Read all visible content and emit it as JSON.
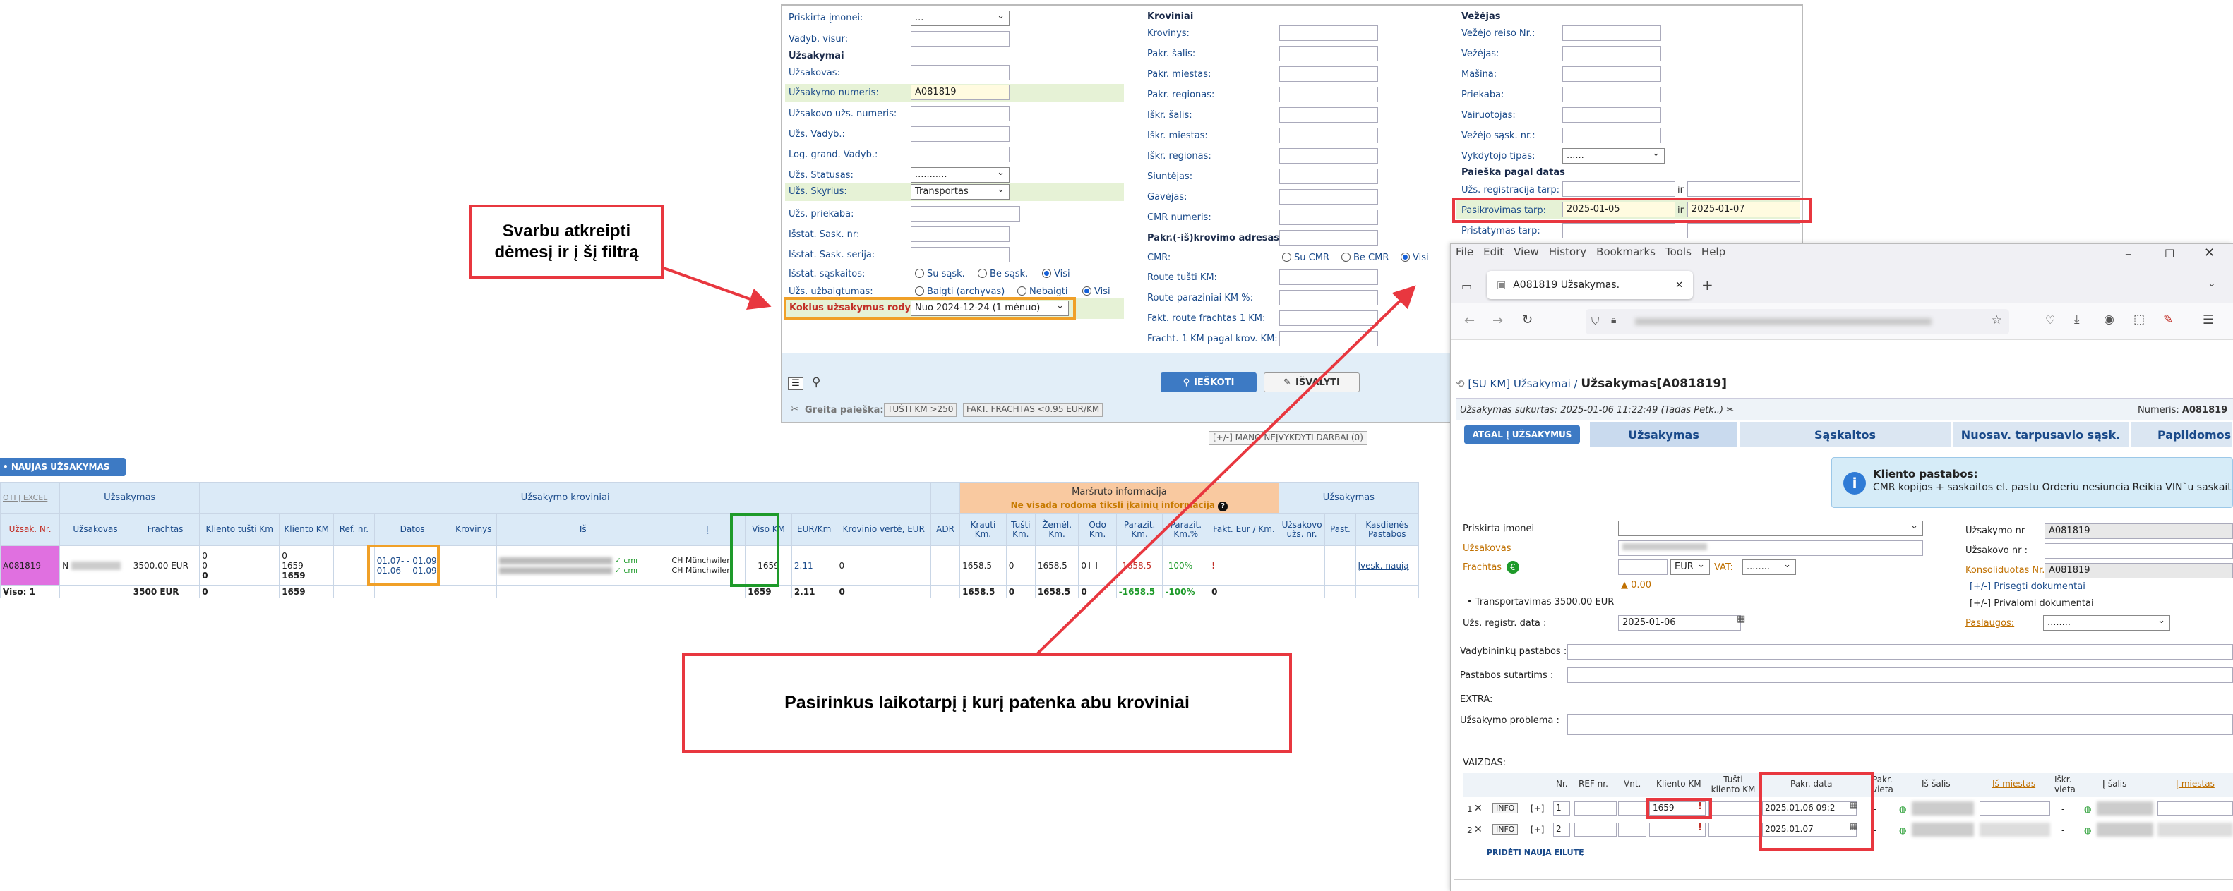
{
  "callouts": {
    "filter_note": "Svarbu atkreipti dėmesį ir į šį filtrą",
    "period_note": "Pasirinkus laikotarpį į kurį patenka abu kroviniai"
  },
  "search_form": {
    "left": {
      "priskirta_label": "Priskirta įmonei:",
      "priskirta_value": "...",
      "vadyb_label": "Vadyb. visur:",
      "section_uzsakymai": "Užsakymai",
      "uzsakovas_label": "Užsakovas:",
      "uzs_nr_label": "Užsakymo numeris:",
      "uzs_nr_value": "A081819",
      "uzsakovo_nr_label": "Užsakovo užs. numeris:",
      "uzs_vadyb_label": "Užs. Vadyb.:",
      "log_grand_label": "Log. grand. Vadyb.:",
      "uzs_status_label": "Užs. Statusas:",
      "uzs_status_value": "...........",
      "uzs_skyrius_label": "Užs. Skyrius:",
      "uzs_skyrius_value": "Transportas",
      "uzs_priekaba_label": "Užs. priekaba:",
      "israst_sask_nr_label": "Išstat. Sask. nr:",
      "israst_sask_serija_label": "Išstat. Sask. serija:",
      "israst_saskaitos_label": "Išstat. sąskaitos:",
      "israst_opts": [
        "Su sąsk.",
        "Be sąsk.",
        "Visi"
      ],
      "uzs_uzbaigtumas_label": "Užs. užbaigtumas:",
      "uzbaig_opts": [
        "Baigti (archyvas)",
        "Nebaigti",
        "Visi"
      ],
      "kokius_label": "Kokius užsakymus rodyti:",
      "kokius_value": "Nuo 2024-12-24 (1 mėnuo)"
    },
    "mid": {
      "section": "Kroviniai",
      "labels": [
        "Krovinys:",
        "Pakr. šalis:",
        "Pakr. miestas:",
        "Pakr. regionas:",
        "Iškr. šalis:",
        "Iškr. miestas:",
        "Iškr. regionas:",
        "Siuntėjas:",
        "Gavėjas:",
        "CMR numeris:"
      ],
      "pakr_adresas": "Pakr.(-iš)krovimo adresas:",
      "cmr_label": "CMR:",
      "cmr_opts": [
        "Su CMR",
        "Be CMR",
        "Visi"
      ],
      "labels2": [
        "Route tušti KM:",
        "Route paraziniai KM %:",
        "Fakt. route frachtas 1 KM:",
        "Fracht. 1 KM pagal krov. KM:"
      ]
    },
    "right": {
      "section": "Vežėjas",
      "labels": [
        "Vežėjo reiso Nr.:",
        "Vežėjas:",
        "Mašina:",
        "Priekaba:",
        "Vairuotojas:",
        "Vežėjo sąsk. nr.:"
      ],
      "vykdytojo_label": "Vykdytojo tipas:",
      "vykdytojo_value": "......",
      "section_datos": "Paieška pagal datas",
      "uzs_reg_label": "Užs. registracija tarp:",
      "pasikr_label": "Pasikrovimas tarp:",
      "pasikr_from": "2025-01-05",
      "pasikr_to": "2025-01-07",
      "pristat_label": "Pristatymas tarp:",
      "ir": "ir"
    },
    "search_btn": "IEŠKOTI",
    "clear_btn": "IŠVALYTI",
    "quick_label": "Greita paieška:",
    "quick1": "TUŠTI KM >250",
    "quick2": "FAKT. FRACHTAS <0.95 EUR/KM"
  },
  "orders": {
    "new_btn": "NAUJAS UŽSAKYMAS",
    "export_btn": "OTI Į EXCEL",
    "toggle": "[+/-] MANO NEĮVYKDYTI DARBAI (0)",
    "group_headers": [
      "Užsakymas",
      "Užsakymo kroviniai",
      "Maršruto informacija",
      "Ne visada rodoma tiksli įkainių informacija",
      "Užsakymas"
    ],
    "headers": [
      "Užsak. Nr.",
      "Užsakovas",
      "Frachtas",
      "Kliento tušti Km",
      "Kliento KM",
      "Ref. nr.",
      "Datos",
      "Krovinys",
      "Iš",
      "Į",
      "Viso KM",
      "EUR/Km",
      "Krovinio vertė, EUR",
      "ADR",
      "Krauti Km.",
      "Tušti Km.",
      "Žemėl. Km.",
      "Odo Km.",
      "Parazit. Km.",
      "Parazit. Km.%",
      "Fakt. Eur / Km.",
      "Užsakovo užs. nr.",
      "Past.",
      "Kasdienės Pastabos"
    ],
    "row": {
      "nr": "A081819",
      "uzsakovas": "N",
      "frachtas": "3500.00 EUR",
      "tusti": [
        "0",
        "0",
        "0"
      ],
      "klientokm": [
        "0",
        "1659",
        "1659"
      ],
      "datos": [
        "01.07- - 01.09",
        "01.06- - 01.09"
      ],
      "i": [
        "CH Münchwilen",
        "CH Münchwilen"
      ],
      "cmr": "✓ cmr",
      "viso": "1659",
      "eurkm": "2.11",
      "verte": "0",
      "krauti": "1658.5",
      "tusti2": "0",
      "zemel": "1658.5",
      "odo": "0",
      "parazit": "-1658.5",
      "parazitp": "-100%",
      "fakt": "!",
      "ived": "Įvesk. naują"
    },
    "total": {
      "label": "Viso: 1",
      "frachtas": "3500 EUR",
      "tusti": "0",
      "klientokm": "1659",
      "viso": "1659",
      "eurkm": "2.11",
      "verte": "0",
      "krauti": "1658.5",
      "tusti2": "0",
      "zemel": "1658.5",
      "odo": "0",
      "parazit": "-1658.5",
      "parazitp": "-100%",
      "fakt": "0"
    }
  },
  "browser": {
    "menu": [
      "File",
      "Edit",
      "View",
      "History",
      "Bookmarks",
      "Tools",
      "Help"
    ],
    "tab_title": "A081819 Užsakymas.",
    "breadcrumb_link": "[SU KM] Užsakymai",
    "breadcrumb_sep": "/",
    "page_title": "Užsakymas[A081819]",
    "created_label": "Užsakymas sukurtas:",
    "created_value": "2025-01-06 11:22:49 (Tadas Petk..)",
    "numeris_label": "Numeris:",
    "numeris_value": "A081819",
    "tabs": [
      "ATGAL Į UŽSAKYMUS",
      "Užsakymas",
      "Sąskaitos",
      "Nuosav. tarpusavio sąsk.",
      "Papildomos"
    ],
    "info_title": "Kliento pastabos:",
    "info_text": "CMR kopijos + saskaitos el. pastu Orderiu nesiuncia Reikia VIN`u saskait",
    "form": {
      "priskirta": "Priskirta įmonei",
      "uzsakovas": "Užsakovas",
      "frachtas": "Frachtas",
      "currency": "EUR",
      "vat": "VAT:",
      "vat_value": "........",
      "diff": "▲ 0.00",
      "transport": "• Transportavimas  3500.00 EUR",
      "reg_label": "Užs. registr. data :",
      "reg_value": "2025-01-06",
      "uzsakymo_nr": "Užsakymo nr",
      "uzsakymo_nr_value": "A081819",
      "uzsakovo_nr": "Užsakovo nr :",
      "konsol": "Konsoliduotas Nr.",
      "konsol_value": "A081819",
      "prisegti": "[+/-] Prisegti dokumentai",
      "privalomi": "[+/-] Privalomi dokumentai",
      "paslaugos": "Paslaugos:",
      "paslaugos_value": "........",
      "vadyb": "Vadybininkų pastabos :",
      "sutartims": "Pastabos sutartims :",
      "extra": "EXTRA:",
      "problema": "Užsakymo problema :"
    },
    "vaizdas": "VAIZDAS:",
    "cargo_headers": [
      "Nr.",
      "REF nr.",
      "Vnt.",
      "Kliento KM",
      "Tušti kliento KM",
      "Pakr. data",
      "Pakr. vieta",
      "Iš-šalis",
      "Iš-miestas",
      "Iškr. vieta",
      "Į-šalis",
      "Į-miestas"
    ],
    "cargo_rows": [
      {
        "idx": "1",
        "nr": "1",
        "info": "INFO",
        "plus": "[+]",
        "km": "1659",
        "date": "2025.01.06 09:2",
        "dash": "-"
      },
      {
        "idx": "2",
        "nr": "2",
        "info": "INFO",
        "plus": "[+]",
        "km": "",
        "date": "2025.01.07",
        "dash": "-"
      }
    ],
    "add_row": "PRIDĖTI NAUJĄ EILUTĘ"
  },
  "colors": {
    "accent_red": "#e8373f",
    "orange": "#f0a028",
    "green": "#1e9a2a",
    "blue": "#1a4a8a",
    "header_bg": "#dbeaf7",
    "magenta": "#e070e0"
  }
}
